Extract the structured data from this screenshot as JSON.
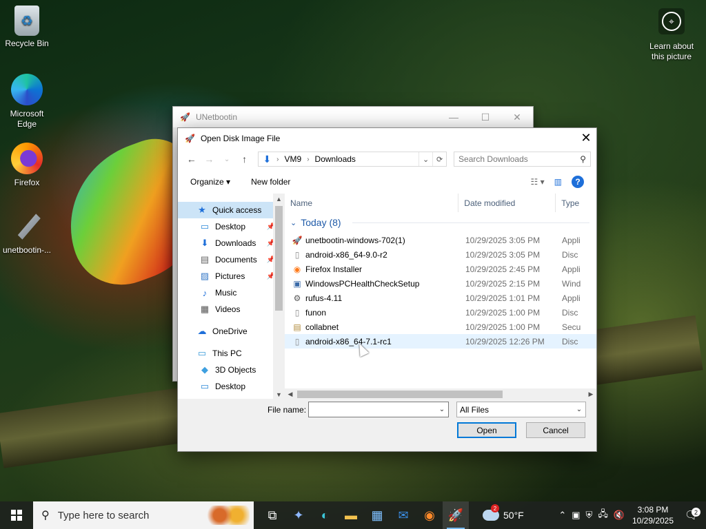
{
  "desktop": {
    "icons": [
      {
        "label": "Recycle Bin",
        "icon": "recycle-bin-icon"
      },
      {
        "label": "Microsoft Edge",
        "icon": "edge-icon"
      },
      {
        "label": "Firefox",
        "icon": "firefox-icon"
      },
      {
        "label": "unetbootin-...",
        "icon": "unetbootin-icon"
      }
    ],
    "learn": {
      "line1": "Learn about",
      "line2": "this picture"
    }
  },
  "unetbootin_window": {
    "title": "UNetbootin"
  },
  "dialog": {
    "title": "Open Disk Image File",
    "address": {
      "segments": [
        "VM9",
        "Downloads"
      ]
    },
    "search_placeholder": "Search Downloads",
    "toolbar": {
      "organize": "Organize ▾",
      "new_folder": "New folder"
    },
    "nav": [
      {
        "label": "Quick access",
        "icon": "star-icon",
        "level": 0,
        "selected": true,
        "pinned": false
      },
      {
        "label": "Desktop",
        "icon": "desktop-folder-icon",
        "level": 1,
        "pinned": true
      },
      {
        "label": "Downloads",
        "icon": "downloads-folder-icon",
        "level": 1,
        "pinned": true
      },
      {
        "label": "Documents",
        "icon": "documents-folder-icon",
        "level": 1,
        "pinned": true
      },
      {
        "label": "Pictures",
        "icon": "pictures-folder-icon",
        "level": 1,
        "pinned": true
      },
      {
        "label": "Music",
        "icon": "music-folder-icon",
        "level": 1,
        "pinned": false
      },
      {
        "label": "Videos",
        "icon": "videos-folder-icon",
        "level": 1,
        "pinned": false
      },
      {
        "label": "OneDrive",
        "icon": "onedrive-icon",
        "level": 0,
        "pinned": false
      },
      {
        "label": "This PC",
        "icon": "this-pc-icon",
        "level": 0,
        "pinned": false
      },
      {
        "label": "3D Objects",
        "icon": "3d-objects-icon",
        "level": 1,
        "pinned": false
      },
      {
        "label": "Desktop",
        "icon": "desktop-folder-icon",
        "level": 1,
        "pinned": false
      }
    ],
    "columns": {
      "name": "Name",
      "date": "Date modified",
      "type": "Type"
    },
    "group_label": "Today (8)",
    "files": [
      {
        "name": "unetbootin-windows-702(1)",
        "date": "10/29/2025 3:05 PM",
        "type": "Appli",
        "icon": "unetbootin-file-icon"
      },
      {
        "name": "android-x86_64-9.0-r2",
        "date": "10/29/2025 3:05 PM",
        "type": "Disc",
        "icon": "disc-image-icon"
      },
      {
        "name": "Firefox Installer",
        "date": "10/29/2025 2:45 PM",
        "type": "Appli",
        "icon": "firefox-installer-icon"
      },
      {
        "name": "WindowsPCHealthCheckSetup",
        "date": "10/29/2025 2:15 PM",
        "type": "Wind",
        "icon": "installer-icon"
      },
      {
        "name": "rufus-4.11",
        "date": "10/29/2025 1:01 PM",
        "type": "Appli",
        "icon": "rufus-icon"
      },
      {
        "name": "funon",
        "date": "10/29/2025 1:00 PM",
        "type": "Disc",
        "icon": "disc-image-icon"
      },
      {
        "name": "collabnet",
        "date": "10/29/2025 1:00 PM",
        "type": "Secu",
        "icon": "certificate-icon"
      },
      {
        "name": "android-x86_64-7.1-rc1",
        "date": "10/29/2025 12:26 PM",
        "type": "Disc",
        "icon": "disc-image-icon",
        "hover": true
      }
    ],
    "footer": {
      "file_name_label": "File name:",
      "file_name_value": "",
      "filter": "All Files",
      "open": "Open",
      "cancel": "Cancel"
    }
  },
  "taskbar": {
    "search_placeholder": "Type here to search",
    "weather": {
      "temp": "50°F",
      "badge": "2"
    },
    "clock": {
      "time": "3:08 PM",
      "date": "10/29/2025"
    },
    "notifications": "2"
  }
}
